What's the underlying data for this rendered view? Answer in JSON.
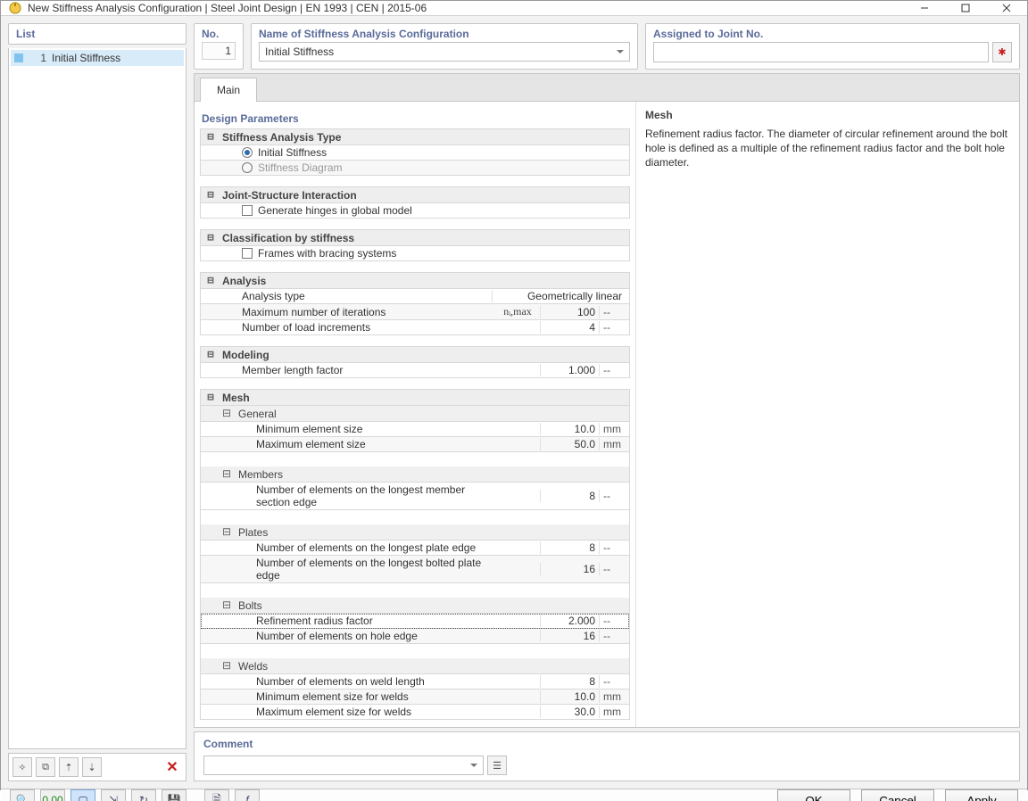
{
  "window": {
    "title": "New Stiffness Analysis Configuration | Steel Joint Design | EN 1993 | CEN | 2015-06"
  },
  "left": {
    "header": "List",
    "item_num": "1",
    "item_label": "Initial Stiffness"
  },
  "top": {
    "no_label": "No.",
    "no_value": "1",
    "name_label": "Name of Stiffness Analysis Configuration",
    "name_value": "Initial Stiffness",
    "assign_label": "Assigned to Joint No.",
    "assign_value": ""
  },
  "tabs": {
    "main": "Main"
  },
  "sections": {
    "design_parameters": "Design Parameters",
    "stiffness_type": "Stiffness Analysis Type",
    "opt_initial": "Initial Stiffness",
    "opt_diagram": "Stiffness Diagram",
    "joint_struct": "Joint-Structure Interaction",
    "gen_hinges": "Generate hinges in global model",
    "classification": "Classification by stiffness",
    "frames_bracing": "Frames with bracing systems",
    "analysis": "Analysis",
    "analysis_type": "Analysis type",
    "analysis_type_val": "Geometrically linear",
    "max_iter": "Maximum number of iterations",
    "max_iter_sym": "nᵢ,max",
    "max_iter_val": "100",
    "load_incr": "Number of load increments",
    "load_incr_val": "4",
    "modeling": "Modeling",
    "member_len": "Member length factor",
    "member_len_val": "1.000",
    "mesh": "Mesh",
    "general": "General",
    "min_elem": "Minimum element size",
    "min_elem_val": "10.0",
    "max_elem": "Maximum element size",
    "max_elem_val": "50.0",
    "members": "Members",
    "memb_edge": "Number of elements on the longest member section edge",
    "memb_edge_val": "8",
    "plates": "Plates",
    "plate_edge": "Number of elements on the longest plate edge",
    "plate_edge_val": "8",
    "plate_bolted": "Number of elements on the longest bolted plate edge",
    "plate_bolted_val": "16",
    "bolts": "Bolts",
    "ref_radius": "Refinement radius factor",
    "ref_radius_val": "2.000",
    "hole_edge": "Number of elements on hole edge",
    "hole_edge_val": "16",
    "welds": "Welds",
    "weld_len": "Number of elements on weld length",
    "weld_len_val": "8",
    "weld_min": "Minimum element size for welds",
    "weld_min_val": "10.0",
    "weld_max": "Maximum element size for welds",
    "weld_max_val": "30.0",
    "unit_mm": "mm",
    "unit_dash": "--"
  },
  "help": {
    "title": "Mesh",
    "text": "Refinement radius factor. The diameter of circular refinement around the bolt hole is defined as a multiple of the refinement radius factor and the bolt hole diameter."
  },
  "comment": {
    "label": "Comment",
    "value": ""
  },
  "footer": {
    "ok": "OK",
    "cancel": "Cancel",
    "apply": "Apply"
  }
}
